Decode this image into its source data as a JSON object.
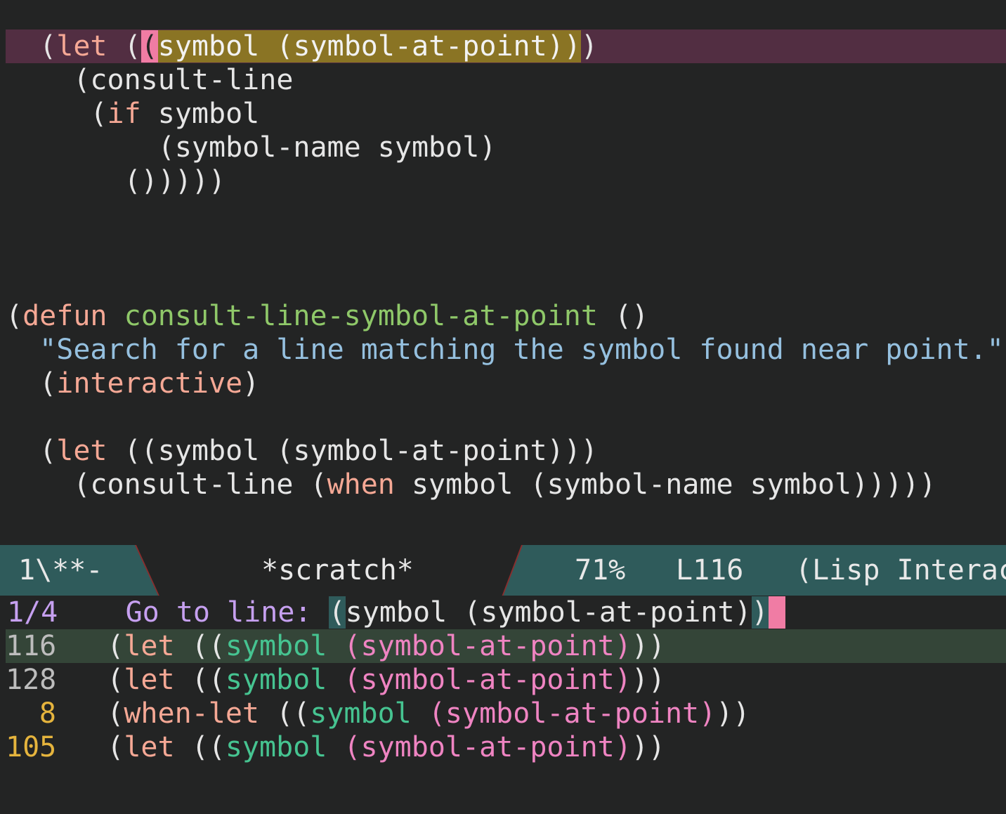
{
  "editor": {
    "lines": [
      [
        "  (",
        "let",
        " (",
        "(",
        "symbol",
        " ",
        "(symbol-at-point)",
        ")",
        ")"
      ],
      [
        "    (consult-line"
      ],
      [
        "     (",
        "if",
        " symbol"
      ],
      [
        "         (symbol-name symbol)"
      ],
      [
        "       ()))))"
      ],
      [
        "(",
        "defun",
        " ",
        "consult-line-symbol-at-point",
        " ()"
      ],
      [
        "  ",
        "\"Search for a line matching the symbol found near point.\""
      ],
      [
        "  (",
        "interactive",
        ")"
      ],
      [
        "  (",
        "let",
        " ((symbol (symbol-at-point)))"
      ],
      [
        "    (consult-line (",
        "when",
        " symbol (symbol-name symbol)))))"
      ]
    ]
  },
  "modeline": {
    "state": "1\\**-",
    "buffer_name": "*scratch*",
    "percent": "71%",
    "line": "L116",
    "mode": "(Lisp Interac"
  },
  "minibuffer": {
    "count": "1/4",
    "prompt": "Go to line: ",
    "input_open": "(",
    "input_mid": "symbol (symbol-at-point)",
    "input_close": ")",
    "candidates": [
      {
        "num": "116",
        "head": "let",
        "open": " ((",
        "symbol": "symbol",
        "sap": "(symbol-at-point)",
        "tail": "))",
        "selected": true,
        "yellow": false
      },
      {
        "num": "128",
        "head": "let",
        "open": " ((",
        "symbol": "symbol",
        "sap": "(symbol-at-point)",
        "tail": "))",
        "selected": false,
        "yellow": false
      },
      {
        "num": "8",
        "head": "when-let",
        "open": " ((",
        "symbol": "symbol",
        "sap": "(symbol-at-point)",
        "tail": "))",
        "selected": false,
        "yellow": true
      },
      {
        "num": "105",
        "head": "let",
        "open": " ((",
        "symbol": "symbol",
        "sap": "(symbol-at-point)",
        "tail": "))",
        "selected": false,
        "yellow": true
      }
    ]
  },
  "colors": {
    "background": "#232424",
    "highlight_line": "#522e42",
    "match": "#8a7424",
    "modeline": "#2f5b5b",
    "keyword": "#f5a895",
    "function_name": "#8fc869",
    "docstring": "#95c0df",
    "candidate_symbol": "#46c491",
    "candidate_call": "#ef84c2",
    "line_number_yellow": "#e5b43d",
    "prompt": "#c6a0f0"
  }
}
